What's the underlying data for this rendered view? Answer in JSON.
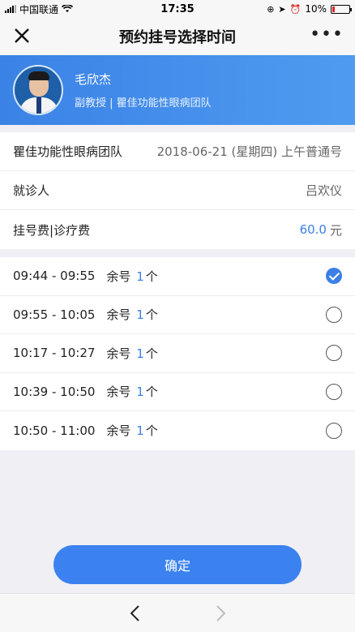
{
  "status_bar": {
    "carrier": "中国联通",
    "time": "17:35",
    "battery": "10%",
    "battery_level": 0.1
  },
  "nav": {
    "title": "预约挂号选择时间"
  },
  "doctor": {
    "name": "毛欣杰",
    "title_team": "副教授 | 瞿佳功能性眼病团队"
  },
  "appointment": {
    "team": "瞿佳功能性眼病团队",
    "date_type": "2018-06-21 (星期四) 上午普通号",
    "patient_label": "就诊人",
    "patient_name": "吕欢仪",
    "fee_label": "挂号费|诊疗费",
    "fee_value": "60.0",
    "fee_unit": "元"
  },
  "slots": [
    {
      "time": "09:44 - 09:55",
      "left_prefix": "余号",
      "count": "1",
      "left_suffix": "个",
      "selected": true
    },
    {
      "time": "09:55 - 10:05",
      "left_prefix": "余号",
      "count": "1",
      "left_suffix": "个",
      "selected": false
    },
    {
      "time": "10:17 - 10:27",
      "left_prefix": "余号",
      "count": "1",
      "left_suffix": "个",
      "selected": false
    },
    {
      "time": "10:39 - 10:50",
      "left_prefix": "余号",
      "count": "1",
      "left_suffix": "个",
      "selected": false
    },
    {
      "time": "10:50 - 11:00",
      "left_prefix": "余号",
      "count": "1",
      "left_suffix": "个",
      "selected": false
    }
  ],
  "confirm_label": "确定",
  "colors": {
    "accent": "#3b82f0",
    "banner": "#4a95ee"
  },
  "icons": {
    "close": "close-icon",
    "more": "more-icon",
    "back": "back-arrow-icon",
    "forward": "forward-arrow-icon"
  }
}
